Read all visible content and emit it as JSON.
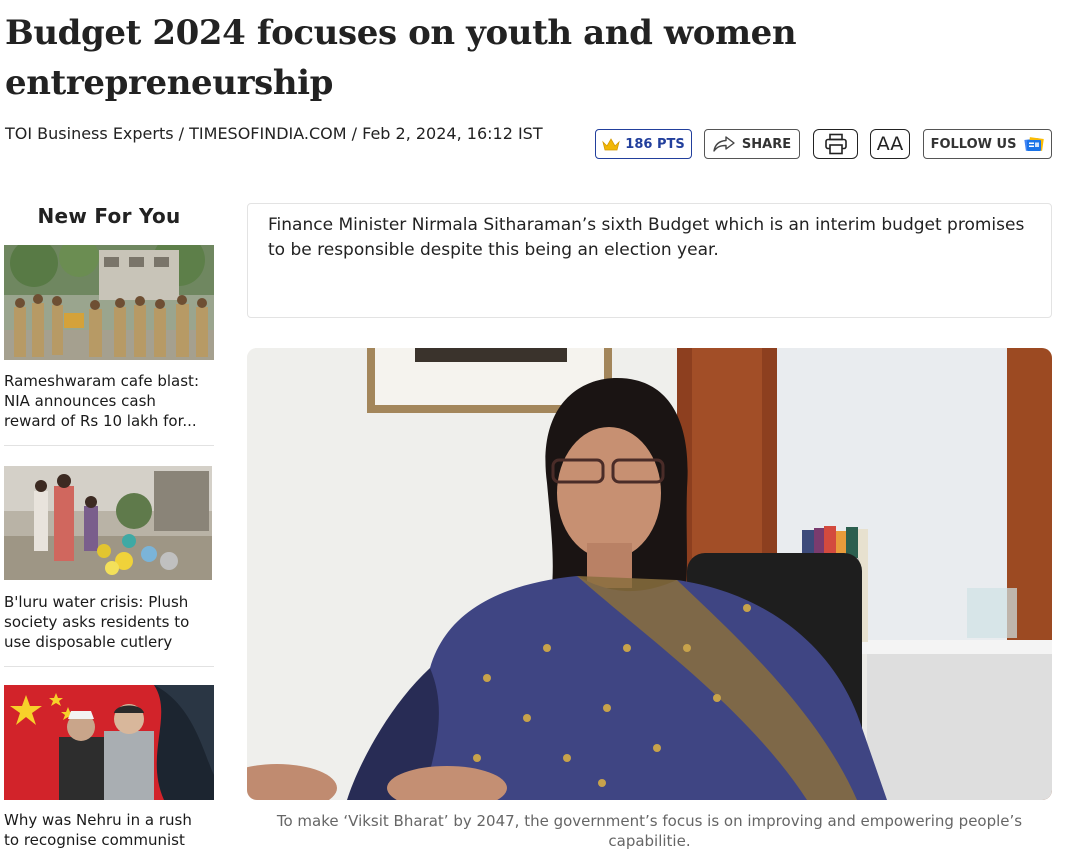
{
  "article": {
    "title": "Budget 2024 focuses on youth and women entrepreneurship",
    "byline": "TOI Business Experts / TIMESOFINDIA.COM / Feb 2, 2024, 16:12 IST",
    "summary": "Finance Minister Nirmala Sitharaman’s sixth Budget which is an interim budget promises to be responsible despite this being an election year.",
    "image_caption": "To make ‘Viksit Bharat’ by 2047, the government’s focus is on improving and empowering people’s capabilitie."
  },
  "toolbar": {
    "points_label": "186 PTS",
    "share_label": "SHARE",
    "font_size_label": "AA",
    "follow_label": "FOLLOW US",
    "accent_color": "#223f9c"
  },
  "sidebar": {
    "title": "New For You",
    "items": [
      {
        "caption": "Rameshwaram cafe blast: NIA announces cash reward of Rs 10 lakh for...",
        "thumb": "police-officers-street"
      },
      {
        "caption": "B'luru water crisis: Plush society asks residents to use disposable cutlery",
        "thumb": "women-collecting-water"
      },
      {
        "caption": "Why was Nehru in a rush to recognise communist",
        "thumb": "nehru-mao-china-flag"
      }
    ]
  },
  "icons": {
    "points": "crown-icon",
    "share": "share-arrow-icon",
    "print": "printer-icon",
    "follow": "google-news-icon"
  }
}
